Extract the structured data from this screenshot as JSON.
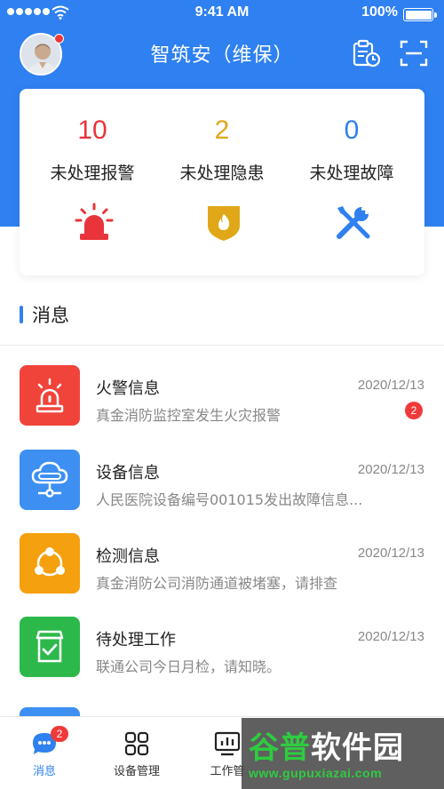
{
  "status_bar": {
    "time": "9:41 AM",
    "battery": "100%"
  },
  "header": {
    "title": "智筑安（维保）",
    "avatar_has_notification": true
  },
  "stats": [
    {
      "value": "10",
      "label": "未处理报警",
      "color": "#E8343A",
      "icon": "alarm-light-icon"
    },
    {
      "value": "2",
      "label": "未处理隐患",
      "color": "#E0A818",
      "icon": "fire-shield-icon"
    },
    {
      "value": "0",
      "label": "未处理故障",
      "color": "#2F80F0",
      "icon": "tools-icon"
    }
  ],
  "section": {
    "title": "消息"
  },
  "messages": [
    {
      "title": "火警信息",
      "date": "2020/12/13",
      "desc": "真金消防监控室发生火灾报警",
      "badge": "2",
      "icon_color": "#F0443A",
      "icon": "alarm-light-icon"
    },
    {
      "title": "设备信息",
      "date": "2020/12/13",
      "desc": "人民医院设备编号001015发出故障信息...",
      "icon_color": "#3D8FF2",
      "icon": "cloud-device-icon"
    },
    {
      "title": "检测信息",
      "date": "2020/12/13",
      "desc": "真金消防公司消防通道被堵塞，请排查",
      "icon_color": "#F5A00F",
      "icon": "network-share-icon"
    },
    {
      "title": "待处理工作",
      "date": "2020/12/13",
      "desc": "联通公司今日月检，请知晓。",
      "icon_color": "#2DB84B",
      "icon": "task-box-icon"
    }
  ],
  "tabs": [
    {
      "label": "消息",
      "badge": "2",
      "active": true,
      "icon": "chat-icon"
    },
    {
      "label": "设备管理",
      "icon": "grid-icon"
    },
    {
      "label": "工作管",
      "icon": "monitor-chart-icon"
    }
  ],
  "watermark": {
    "text_a": "谷普",
    "text_b": "软件园",
    "url": "www.gupuxiazai.com"
  },
  "colors": {
    "primary": "#2F80F0",
    "red": "#E8343A",
    "yellow": "#E0A818"
  }
}
